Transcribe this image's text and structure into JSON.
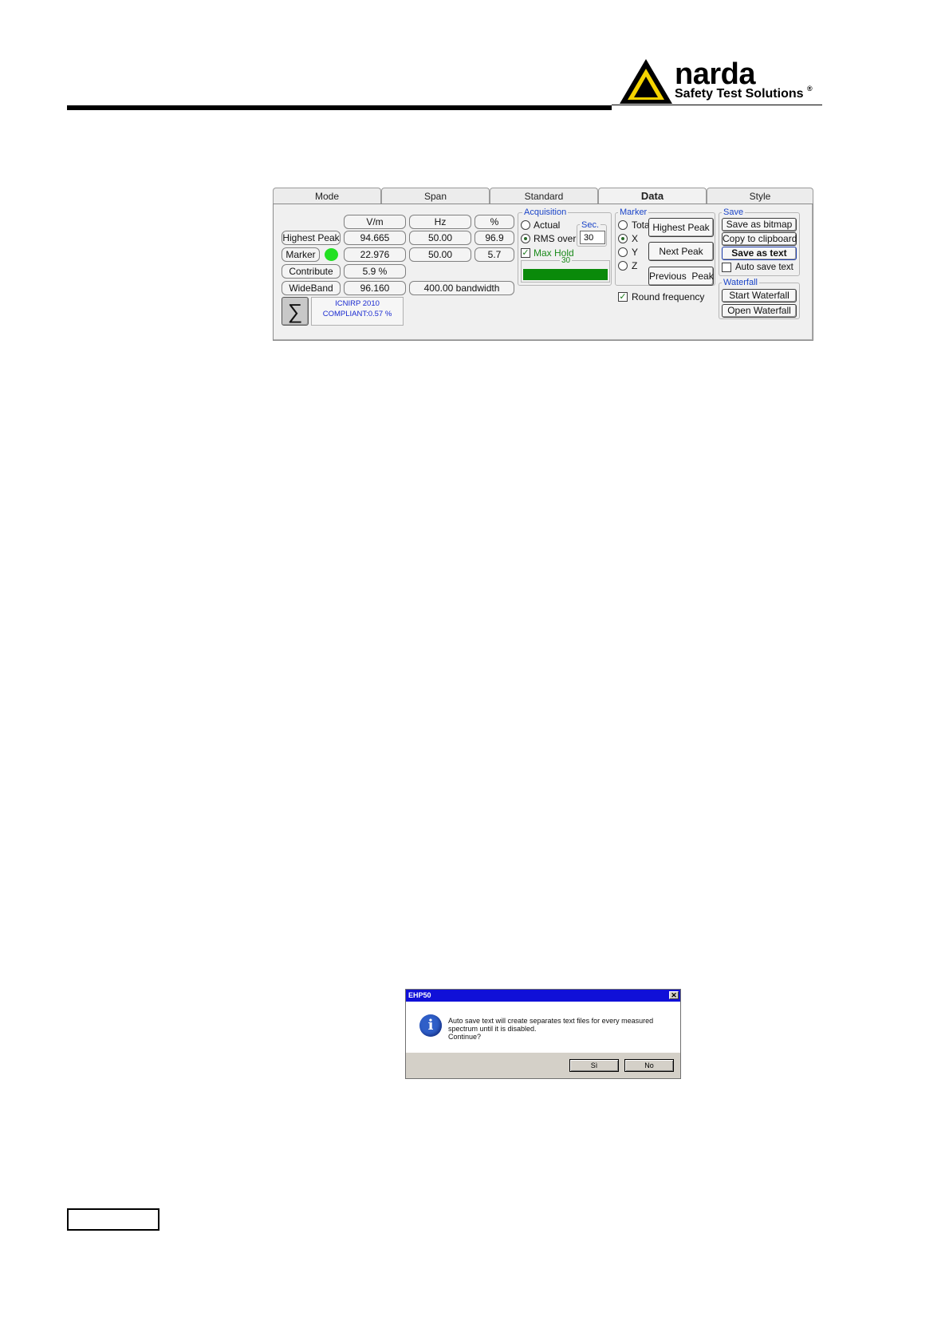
{
  "header": {
    "logo_name": "narda",
    "logo_tagline": "Safety Test Solutions",
    "logo_reg": "®"
  },
  "tabs": [
    {
      "label": "Mode",
      "active": false
    },
    {
      "label": "Span",
      "active": false
    },
    {
      "label": "Standard",
      "active": false
    },
    {
      "label": "Data",
      "active": true
    },
    {
      "label": "Style",
      "active": false
    }
  ],
  "data_table": {
    "columns": [
      "V/m",
      "Hz",
      "%"
    ],
    "rows": {
      "highest_peak": {
        "label": "Highest Peak",
        "vm": "94.665",
        "hz": "50.00",
        "pct": "96.9"
      },
      "marker": {
        "label": "Marker",
        "vm": "22.976",
        "hz": "50.00",
        "pct": "5.7",
        "indicator_color": "#22e022"
      },
      "contribute": {
        "label": "Contribute",
        "vm": "5.9 %"
      },
      "wideband": {
        "label": "WideBand",
        "vm": "96.160",
        "bandwidth": "400.00 bandwidth"
      }
    },
    "sum_symbol": "∑",
    "compliance_line1": "ICNIRP 2010",
    "compliance_line2": "COMPLIANT:0.57 %"
  },
  "acquisition": {
    "title": "Acquisition",
    "actual_label": "Actual",
    "rms_label": "RMS over",
    "sec_title": "Sec.",
    "sec_value": "30",
    "maxhold_label": "Max Hold",
    "maxhold_checked": true,
    "rms_selected": true,
    "progress_value": "30",
    "progress_fraction": 1.0,
    "progress_color": "#0a8a0a"
  },
  "marker_group": {
    "title": "Marker",
    "options": [
      "Total",
      "X",
      "Y",
      "Z"
    ],
    "selected": "X",
    "highest_peak_btn": "Highest Peak",
    "next_peak_btn": "Next Peak",
    "previous_peak_btn": "Previous  Peak",
    "round_frequency_label": "Round frequency",
    "round_frequency_checked": true
  },
  "save_group": {
    "title": "Save",
    "save_bitmap_btn": "Save as bitmap",
    "copy_clipboard_btn": "Copy to clipboard",
    "save_text_btn": "Save as text",
    "auto_save_label": "Auto save text",
    "auto_save_checked": false
  },
  "waterfall_group": {
    "title": "Waterfall",
    "start_btn": "Start Waterfall",
    "open_btn": "Open Waterfall"
  },
  "dialog": {
    "title": "EHP50",
    "close_glyph": "✕",
    "message_line1": "Auto save text will create separates text files for every measured",
    "message_line2": "spectrum until it is disabled.",
    "message_line3": "Continue?",
    "yes_btn": "Sì",
    "no_btn": "No"
  }
}
